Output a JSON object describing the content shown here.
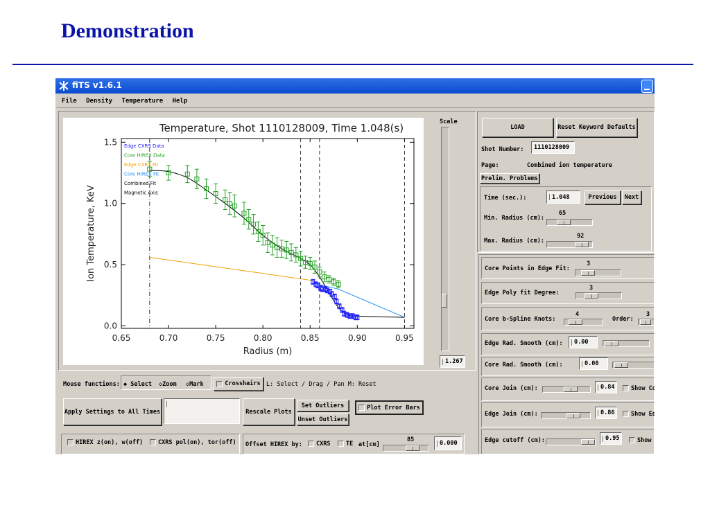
{
  "slide": {
    "title": "Demonstration"
  },
  "window": {
    "title": "fiTS v1.6.1"
  },
  "menu": [
    "File",
    "Density",
    "Temperature",
    "Help"
  ],
  "scale": {
    "label": "Scale",
    "value": "1.267"
  },
  "chart_data": {
    "type": "scatter",
    "title": "Temperature, Shot 1110128009, Time 1.048(s)",
    "xlabel": "Radius (m)",
    "ylabel": "Ion Temperature, KeV",
    "xlim": [
      0.65,
      0.96
    ],
    "ylim": [
      -0.02,
      1.53
    ],
    "xticks": [
      "0.65",
      "0.70",
      "0.75",
      "0.80",
      "0.85",
      "0.90",
      "0.95"
    ],
    "yticks": [
      "0.0",
      "0.5",
      "1.0",
      "1.5"
    ],
    "legend": {
      "placement": "top-left",
      "entries": [
        "Edge CXRS Data",
        "Core HIREX Data",
        "Edge CXRS Fit",
        "Core HIREX Fit",
        "Combined Fit",
        "Magnetic Axis"
      ]
    },
    "colors": {
      "edge_cxrs_data": "#1a1aff",
      "core_hirex_data": "#22a022",
      "edge_cxrs_fit": "#f0a000",
      "core_hirex_fit": "#1e90ff",
      "combined_fit": "#000000",
      "magnetic_axis": "#000000"
    },
    "vlines": [
      {
        "x": 0.68,
        "style": "dashdot"
      },
      {
        "x": 0.84,
        "style": "dashed"
      },
      {
        "x": 0.86,
        "style": "dashed"
      },
      {
        "x": 0.95,
        "style": "dashed"
      }
    ],
    "series": [
      {
        "name": "Core HIREX Data",
        "x": [
          0.68,
          0.7,
          0.72,
          0.73,
          0.74,
          0.75,
          0.76,
          0.765,
          0.77,
          0.78,
          0.785,
          0.79,
          0.795,
          0.8,
          0.805,
          0.81,
          0.815,
          0.82,
          0.825,
          0.83,
          0.835,
          0.84,
          0.845,
          0.85,
          0.855,
          0.86,
          0.865,
          0.87,
          0.875,
          0.88
        ],
        "y": [
          1.28,
          1.25,
          1.24,
          1.2,
          1.12,
          1.08,
          1.03,
          1.0,
          0.98,
          0.92,
          0.87,
          0.83,
          0.77,
          0.74,
          0.68,
          0.66,
          0.64,
          0.63,
          0.62,
          0.6,
          0.58,
          0.55,
          0.52,
          0.51,
          0.48,
          0.44,
          0.4,
          0.38,
          0.36,
          0.34
        ],
        "err": [
          0.06,
          0.06,
          0.07,
          0.08,
          0.08,
          0.08,
          0.08,
          0.09,
          0.09,
          0.09,
          0.08,
          0.08,
          0.08,
          0.08,
          0.08,
          0.08,
          0.08,
          0.07,
          0.07,
          0.07,
          0.06,
          0.06,
          0.05,
          0.05,
          0.05,
          0.04,
          0.04,
          0.03,
          0.03,
          0.03
        ]
      },
      {
        "name": "Edge CXRS Data",
        "x": [
          0.853,
          0.856,
          0.858,
          0.861,
          0.863,
          0.866,
          0.868,
          0.871,
          0.873,
          0.876,
          0.878,
          0.881,
          0.884,
          0.886,
          0.889,
          0.892,
          0.895,
          0.898,
          0.9
        ],
        "y": [
          0.36,
          0.34,
          0.33,
          0.31,
          0.3,
          0.3,
          0.29,
          0.28,
          0.26,
          0.24,
          0.2,
          0.16,
          0.13,
          0.1,
          0.09,
          0.08,
          0.08,
          0.07,
          0.07
        ],
        "err": [
          0.02,
          0.02,
          0.02,
          0.02,
          0.02,
          0.02,
          0.02,
          0.02,
          0.02,
          0.02,
          0.02,
          0.02,
          0.02,
          0.02,
          0.02,
          0.02,
          0.02,
          0.02,
          0.02
        ]
      },
      {
        "name": "Edge CXRS Fit",
        "x": [
          0.68,
          0.853
        ],
        "y": [
          0.56,
          0.37
        ]
      },
      {
        "name": "Core HIREX Fit",
        "x": [
          0.853,
          0.88,
          0.95
        ],
        "y": [
          0.35,
          0.3,
          0.07
        ]
      },
      {
        "name": "Combined Fit",
        "x": [
          0.68,
          0.7,
          0.72,
          0.74,
          0.76,
          0.78,
          0.8,
          0.82,
          0.84,
          0.85,
          0.86,
          0.87,
          0.88,
          0.89,
          0.9,
          0.95
        ],
        "y": [
          1.27,
          1.26,
          1.21,
          1.11,
          1.0,
          0.88,
          0.74,
          0.63,
          0.55,
          0.5,
          0.4,
          0.27,
          0.15,
          0.09,
          0.08,
          0.07
        ]
      }
    ]
  },
  "mouse": {
    "label": "Mouse functions:",
    "options": [
      "Select",
      "Zoom",
      "Mark"
    ],
    "crosshairs": "Crosshairs",
    "help": "L: Select / Drag / Pan  M: Reset"
  },
  "buttons": {
    "apply": "Apply Settings to All Times",
    "rescale": "Rescale Plots",
    "set_outliers": "Set Outliers",
    "unset_outliers": "Unset Outliers",
    "plot_error_bars": "Plot Error Bars"
  },
  "bottom": {
    "hirex": "HIREX z(on), w(off)",
    "cxrs": "CXRS pol(on), tor(off)",
    "offset_label": "Offset HIREX by:",
    "cxrs_opt": "CXRS",
    "te_opt": "TE",
    "at_label": "at[cm]",
    "at_value": "85",
    "offset_value": "0.000"
  },
  "right": {
    "load": "LOAD",
    "reset": "Reset Keyword Defaults",
    "shot_label": "Shot Number:",
    "shot_value": "1110128009",
    "page_label": "Page:",
    "page_value": "Combined ion temperature",
    "prelim": "Prelim. Problems",
    "time_label": "Time (sec.):",
    "time_value": "1.048",
    "previous": "Previous",
    "next": "Next",
    "min_radius_label": "Min. Radius (cm):",
    "min_radius_value": "65",
    "max_radius_label": "Max. Radius (cm):",
    "max_radius_value": "92",
    "core_points_label": "Core Points in Edge Fit:",
    "core_points_value": "3",
    "edge_poly_label": "Edge Poly fit Degree:",
    "edge_poly_value": "3",
    "core_knots_label": "Core b-Spline Knots:",
    "core_knots_value": "4",
    "order_label": "Order:",
    "order_value": "3",
    "edge_smooth_label": "Edge Rad. Smooth (cm):",
    "edge_smooth_value": "0.00",
    "core_smooth_label": "Core Rad. Smooth (cm):",
    "core_smooth_value": "0.00",
    "core_join_label": "Core Join (cm):",
    "core_join_value": "0.84",
    "show_co": "Show Co",
    "edge_join_label": "Edge Join (cm):",
    "edge_join_value": "0.86",
    "show_ed": "Show Ed",
    "edge_cutoff_label": "Edge cutoff (cm):",
    "edge_cutoff_value": "0.95",
    "show": "Show"
  }
}
